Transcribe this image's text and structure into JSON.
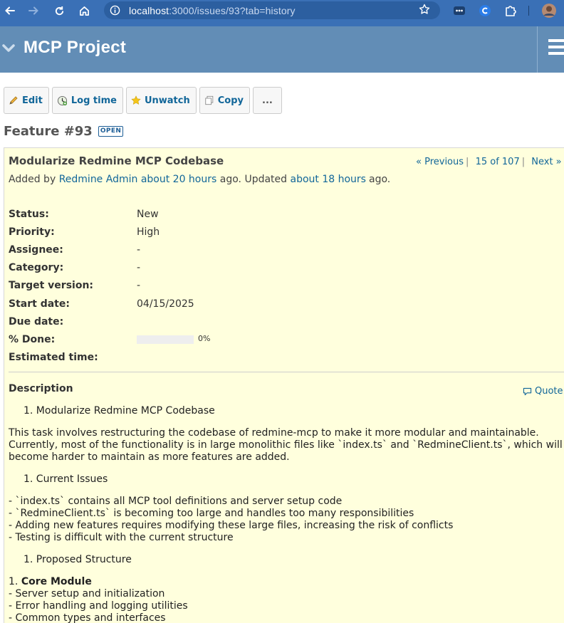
{
  "browser": {
    "url_host": "localhost",
    "url_path": ":3000/issues/93?tab=history"
  },
  "header": {
    "project_title": "MCP Project"
  },
  "toolbar": {
    "edit": "Edit",
    "log_time": "Log time",
    "unwatch": "Unwatch",
    "copy": "Copy",
    "more": "..."
  },
  "issue": {
    "heading": "Feature #93",
    "status_badge": "OPEN",
    "subject": "Modularize Redmine MCP Codebase",
    "pager": {
      "previous": "« Previous",
      "position": "15 of 107",
      "next": "Next »"
    },
    "author_line": {
      "added_by": "Added by",
      "author": "Redmine Admin",
      "added_ago": "about 20 hours",
      "ago_updated": "ago. Updated",
      "updated_ago": "about 18 hours",
      "ago": "ago."
    },
    "attributes": [
      {
        "label": "Status:",
        "value": "New"
      },
      {
        "label": "Priority:",
        "value": "High"
      },
      {
        "label": "Assignee:",
        "value": "-"
      },
      {
        "label": "Category:",
        "value": "-"
      },
      {
        "label": "Target version:",
        "value": "-"
      },
      {
        "label": "Start date:",
        "value": "04/15/2025"
      },
      {
        "label": "Due date:",
        "value": ""
      },
      {
        "label": "% Done:",
        "value": "0%"
      },
      {
        "label": "Estimated time:",
        "value": ""
      }
    ],
    "done_ratio": 0,
    "description": {
      "title": "Description",
      "quote": "Quote",
      "item1": "1. Modularize Redmine MCP Codebase",
      "para1": "This task involves restructuring the codebase of redmine-mcp to make it more modular and maintainable. Currently, most of the functionality is in large monolithic files like `index.ts` and `RedmineClient.ts`, which will become harder to maintain as more features are added.",
      "item2": "1. Current Issues",
      "issues": [
        "- `index.ts` contains all MCP tool definitions and server setup code",
        "- `RedmineClient.ts` is becoming too large and handles too many responsibilities",
        "- Adding new features requires modifying these large files, increasing the risk of conflicts",
        "- Testing is difficult with the current structure"
      ],
      "item3": "1. Proposed Structure",
      "core_prefix": "1. ",
      "core_title": "Core Module",
      "core_items": [
        "- Server setup and initialization",
        "- Error handling and logging utilities",
        "- Common types and interfaces"
      ]
    }
  }
}
